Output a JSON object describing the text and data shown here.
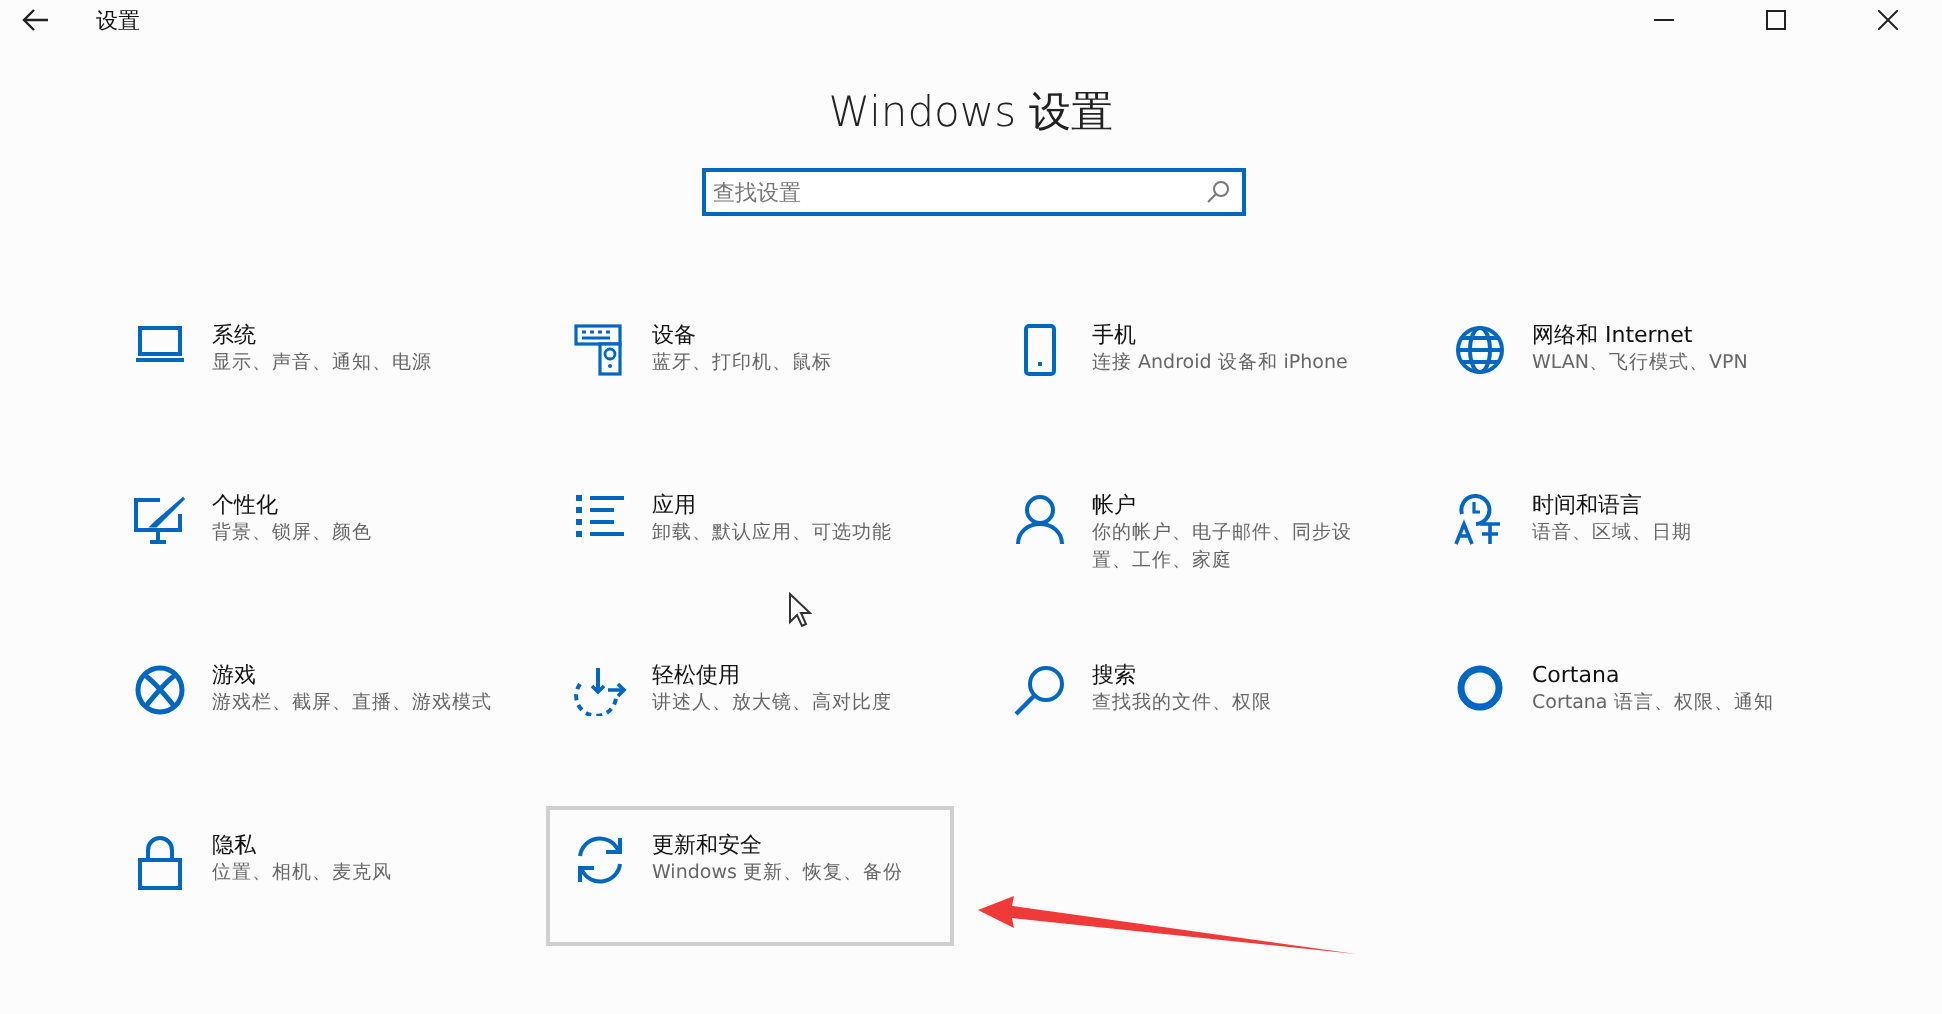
{
  "window": {
    "title": "设置"
  },
  "heading": "Windows 设置",
  "search": {
    "placeholder": "查找设置"
  },
  "tiles": [
    {
      "title": "系统",
      "subtitle": "显示、声音、通知、电源",
      "selected": false
    },
    {
      "title": "设备",
      "subtitle": "蓝牙、打印机、鼠标",
      "selected": false
    },
    {
      "title": "手机",
      "subtitle": "连接 Android 设备和 iPhone",
      "selected": false
    },
    {
      "title": "网络和 Internet",
      "subtitle": "WLAN、飞行模式、VPN",
      "selected": false
    },
    {
      "title": "个性化",
      "subtitle": "背景、锁屏、颜色",
      "selected": false
    },
    {
      "title": "应用",
      "subtitle": "卸载、默认应用、可选功能",
      "selected": false
    },
    {
      "title": "帐户",
      "subtitle": "你的帐户、电子邮件、同步设置、工作、家庭",
      "selected": false
    },
    {
      "title": "时间和语言",
      "subtitle": "语音、区域、日期",
      "selected": false
    },
    {
      "title": "游戏",
      "subtitle": "游戏栏、截屏、直播、游戏模式",
      "selected": false
    },
    {
      "title": "轻松使用",
      "subtitle": "讲述人、放大镜、高对比度",
      "selected": false
    },
    {
      "title": "搜索",
      "subtitle": "查找我的文件、权限",
      "selected": false
    },
    {
      "title": "Cortana",
      "subtitle": "Cortana 语言、权限、通知",
      "selected": false
    },
    {
      "title": "隐私",
      "subtitle": "位置、相机、麦克风",
      "selected": false
    },
    {
      "title": "更新和安全",
      "subtitle": "Windows 更新、恢复、备份",
      "selected": true
    }
  ]
}
